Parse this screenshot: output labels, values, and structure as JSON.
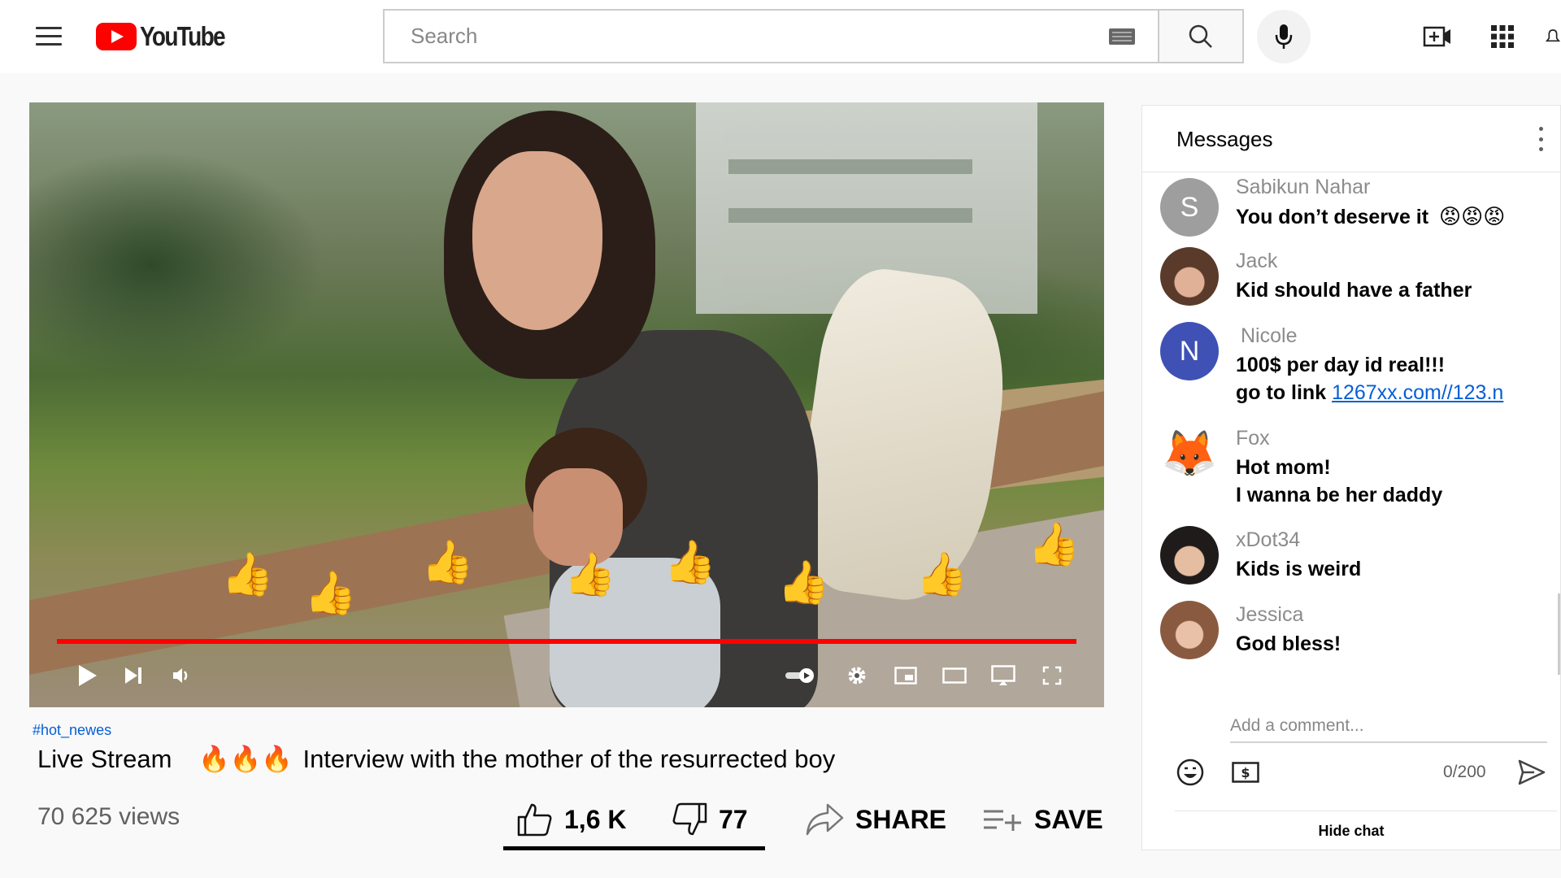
{
  "header": {
    "logo_text": "YouTube",
    "search_placeholder": "Search"
  },
  "player": {
    "progress_fraction": 1.0
  },
  "video": {
    "hashtag": "#hot_newes",
    "title_prefix": "Live Stream",
    "title_emojis": "🔥🔥🔥",
    "title_text": "Interview with the mother of the resurrected boy",
    "views": "70 625 views",
    "likes": "1,6 K",
    "dislikes": "77",
    "share_label": "SHARE",
    "save_label": "SAVE"
  },
  "chat": {
    "title": "Messages",
    "messages": [
      {
        "author": "Sabikun Nahar",
        "initial": "S",
        "lines": [
          "You don’t deserve it"
        ],
        "emojis": "😡😡😡",
        "avatar_color": "#9e9e9e"
      },
      {
        "author": "Jack",
        "initial": "",
        "lines": [
          "Kid should have a father"
        ],
        "avatar_color": "#7a5a48"
      },
      {
        "author": "Nicole",
        "initial": "N",
        "lines": [
          "100$ per day id real!!!",
          "go to link"
        ],
        "link": "1267xx.com//123.n",
        "avatar_color": "#3f51b5"
      },
      {
        "author": "Fox",
        "initial": "🦊",
        "lines": [
          "Hot mom!",
          "I wanna be her daddy"
        ],
        "avatar_color": "#ffffff"
      },
      {
        "author": "xDot34",
        "initial": "",
        "lines": [
          "Kids is weird"
        ],
        "avatar_color": "#5a4a40"
      },
      {
        "author": "Jessica",
        "initial": "",
        "lines": [
          "God bless!"
        ],
        "avatar_color": "#8a6a58"
      }
    ],
    "comment_placeholder": "Add a comment...",
    "counter": "0/200",
    "hide_chat_label": "Hide chat"
  },
  "colors": {
    "brand_red": "#ff0000",
    "link_blue": "#065fd4"
  }
}
